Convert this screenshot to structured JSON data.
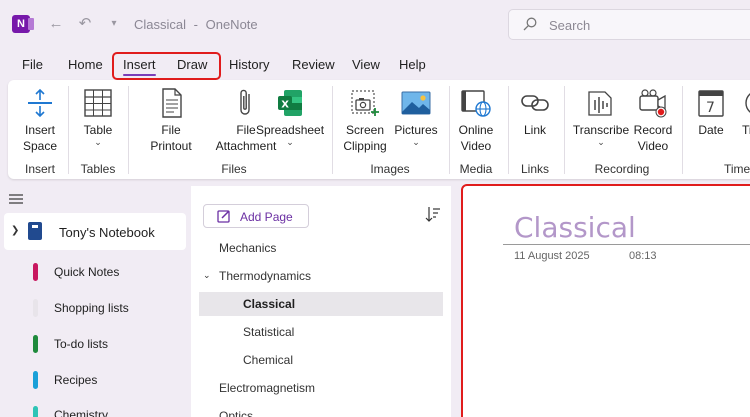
{
  "titlebar": {
    "title": "Classical",
    "separator": "-",
    "app_name": "OneNote",
    "logo_letter": "N",
    "search_placeholder": "Search"
  },
  "menu": {
    "tabs": [
      "File",
      "Home",
      "Insert",
      "Draw",
      "History",
      "Review",
      "View",
      "Help"
    ],
    "active_tab": "Insert"
  },
  "ribbon": {
    "buttons": {
      "insert_space": [
        "Insert",
        "Space"
      ],
      "table": "Table",
      "file_printout": [
        "File",
        "Printout"
      ],
      "file_attachment": [
        "File",
        "Attachment"
      ],
      "spreadsheet": "Spreadsheet",
      "screen_clipping": [
        "Screen",
        "Clipping"
      ],
      "pictures": "Pictures",
      "online_video": [
        "Online",
        "Video"
      ],
      "link": "Link",
      "transcribe": "Transcribe",
      "record_video": [
        "Record",
        "Video"
      ],
      "date": "Date",
      "time_partial": "Ti"
    },
    "groups": {
      "insert": "Insert",
      "tables": "Tables",
      "files": "Files",
      "images": "Images",
      "media": "Media",
      "links": "Links",
      "recording": "Recording",
      "time": "Time"
    }
  },
  "nav": {
    "notebook": "Tony's Notebook",
    "sections": [
      {
        "label": "Quick Notes",
        "color": "#c8175f"
      },
      {
        "label": "Shopping lists",
        "color": "#e8e4ea"
      },
      {
        "label": "To-do lists",
        "color": "#1f8a3c"
      },
      {
        "label": "Recipes",
        "color": "#1aa0d8"
      },
      {
        "label": "Chemistry",
        "color": "#2ec4b6"
      }
    ]
  },
  "pages": {
    "add_label": "Add Page",
    "items": [
      {
        "label": "Mechanics",
        "level": 0
      },
      {
        "label": "Thermodynamics",
        "level": 0,
        "expanded": true
      },
      {
        "label": "Classical",
        "level": 1,
        "selected": true
      },
      {
        "label": "Statistical",
        "level": 1
      },
      {
        "label": "Chemical",
        "level": 1
      },
      {
        "label": "Electromagnetism",
        "level": 0
      },
      {
        "label": "Optics",
        "level": 0
      }
    ]
  },
  "note": {
    "title": "Classical",
    "date": "11 August 2025",
    "time": "08:13"
  },
  "colors": {
    "accent": "#7a3db8",
    "highlight": "#e01c1c",
    "page_title": "#b397c9"
  }
}
